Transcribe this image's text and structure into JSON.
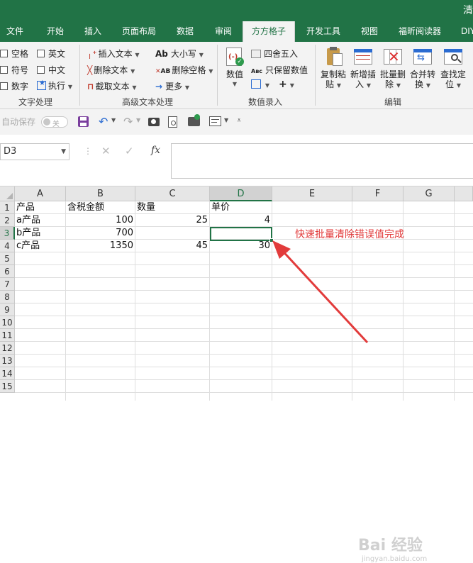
{
  "window": {
    "title": "清"
  },
  "tabs": [
    "文件",
    "开始",
    "插入",
    "页面布局",
    "数据",
    "审阅",
    "方方格子",
    "开发工具",
    "视图",
    "福昕阅读器",
    "DIY"
  ],
  "active_tab": "方方格子",
  "ribbon": {
    "text_processing": {
      "checkboxes": [
        "空格",
        "英文",
        "符号",
        "中文",
        "数字"
      ],
      "execute_label": "执行",
      "group_label": "文字处理"
    },
    "advanced_text": {
      "items": [
        "插入文本",
        "大小写",
        "删除文本",
        "删除空格",
        "截取文本",
        "更多"
      ],
      "group_label": "高级文本处理"
    },
    "data_entry": {
      "numeric_label": "数值",
      "round_label": "四舍五入",
      "keep_value_label": "只保留数值",
      "group_label": "数值录入"
    },
    "edit": {
      "buttons": [
        {
          "line1": "复制粘",
          "line2": "贴"
        },
        {
          "line1": "新增插",
          "line2": "入"
        },
        {
          "line1": "批量删",
          "line2": "除"
        },
        {
          "line1": "合并转",
          "line2": "换"
        },
        {
          "line1": "查找定",
          "line2": "位"
        }
      ],
      "group_label": "编辑"
    }
  },
  "qat": {
    "autosave_label": "自动保存",
    "toggle_state": "关"
  },
  "formula_bar": {
    "name_box": "D3",
    "formula": "",
    "fx": "fx"
  },
  "sheet": {
    "columns": [
      "A",
      "B",
      "C",
      "D",
      "E",
      "F",
      "G"
    ],
    "selected_column": "D",
    "rows": [
      "1",
      "2",
      "3",
      "4",
      "5",
      "6",
      "7",
      "8",
      "9",
      "10",
      "11",
      "12",
      "13",
      "14",
      "15"
    ],
    "selected_row": "3",
    "headers": {
      "A1": "产品",
      "B1": "含税金额",
      "C1": "数量",
      "D1": "单价"
    },
    "data": [
      {
        "A": "a产品",
        "B": "100",
        "C": "25",
        "D": "4"
      },
      {
        "A": "b产品",
        "B": "700",
        "C": "",
        "D": ""
      },
      {
        "A": "c产品",
        "B": "1350",
        "C": "45",
        "D": "30"
      }
    ]
  },
  "annotation": {
    "text": "快速批量清除错误值完成",
    "color": "#e23b3b"
  },
  "watermark": {
    "text": "Bai 经验",
    "subtext": "jingyan.baidu.com"
  },
  "colors": {
    "accent": "#217346",
    "annotation": "#e23b3b"
  }
}
